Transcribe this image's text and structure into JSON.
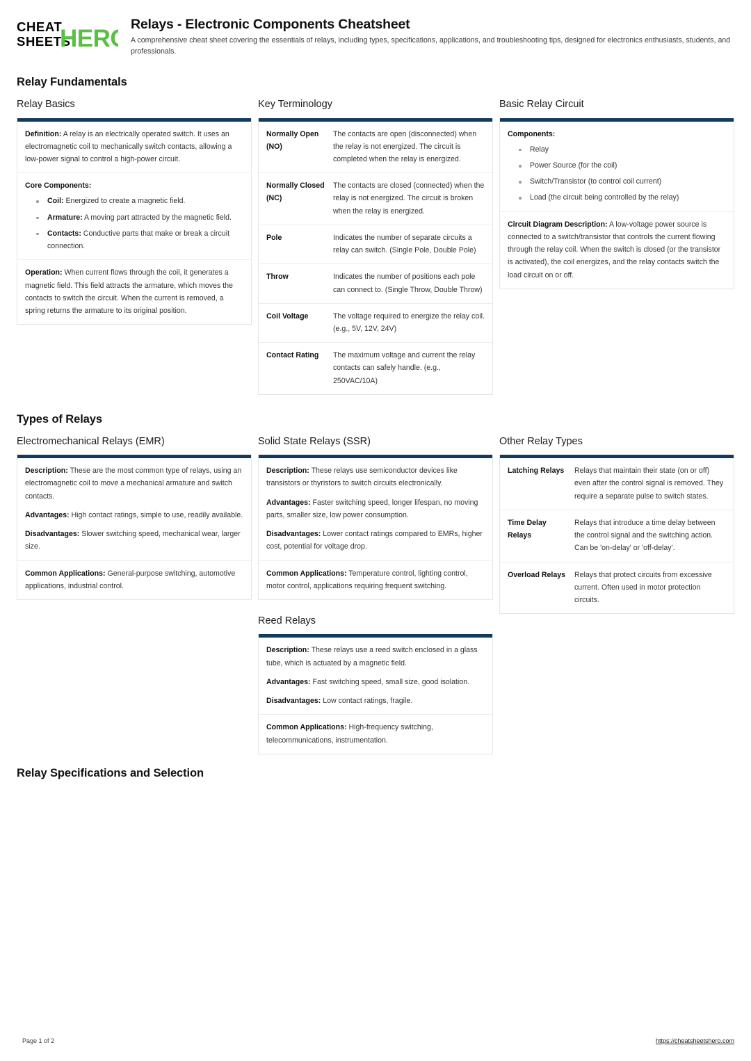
{
  "brand": {
    "line1": "CHEAT",
    "line2": "SHEETS",
    "accent_word": "HERO",
    "accent_color": "#5cbf45",
    "text_color": "#000000"
  },
  "header": {
    "title": "Relays - Electronic Components Cheatsheet",
    "subtitle": "A comprehensive cheat sheet covering the essentials of relays, including types, specifications, applications, and troubleshooting tips, designed for electronics enthusiasts, students, and professionals."
  },
  "theme": {
    "accent_bar": "#143a5e",
    "card_border": "#e4e4e4",
    "row_divider": "#ededed"
  },
  "sections": [
    {
      "id": "fundamentals",
      "title": "Relay Fundamentals"
    },
    {
      "id": "types",
      "title": "Types of Relays"
    },
    {
      "id": "specs",
      "title": "Relay Specifications and Selection"
    }
  ],
  "cards": {
    "relay_basics": {
      "title": "Relay Basics",
      "definition_label": "Definition:",
      "definition_text": " A relay is an electrically operated switch. It uses an electromagnetic coil to mechanically switch contacts, allowing a low-power signal to control a high-power circuit.",
      "core_label": "Core Components:",
      "core_items": [
        {
          "term": "Coil:",
          "desc": " Energized to create a magnetic field."
        },
        {
          "term": "Armature:",
          "desc": " A moving part attracted by the magnetic field."
        },
        {
          "term": "Contacts:",
          "desc": " Conductive parts that make or break a circuit connection."
        }
      ],
      "operation_label": "Operation:",
      "operation_text": " When current flows through the coil, it generates a magnetic field. This field attracts the armature, which moves the contacts to switch the circuit. When the current is removed, a spring returns the armature to its original position."
    },
    "key_terminology": {
      "title": "Key Terminology",
      "rows": [
        {
          "key": "Normally Open (NO)",
          "value": "The contacts are open (disconnected) when the relay is not energized. The circuit is completed when the relay is energized."
        },
        {
          "key": "Normally Closed (NC)",
          "value": "The contacts are closed (connected) when the relay is not energized. The circuit is broken when the relay is energized."
        },
        {
          "key": "Pole",
          "value": "Indicates the number of separate circuits a relay can switch. (Single Pole, Double Pole)"
        },
        {
          "key": "Throw",
          "value": "Indicates the number of positions each pole can connect to. (Single Throw, Double Throw)"
        },
        {
          "key": "Coil Voltage",
          "value": "The voltage required to energize the relay coil. (e.g., 5V, 12V, 24V)"
        },
        {
          "key": "Contact Rating",
          "value": "The maximum voltage and current the relay contacts can safely handle. (e.g., 250VAC/10A)"
        }
      ]
    },
    "basic_relay_circuit": {
      "title": "Basic Relay Circuit",
      "components_label": "Components:",
      "components": [
        "Relay",
        "Power Source (for the coil)",
        "Switch/Transistor (to control coil current)",
        "Load (the circuit being controlled by the relay)"
      ],
      "diagram_label": "Circuit Diagram Description:",
      "diagram_text": " A low-voltage power source is connected to a switch/transistor that controls the current flowing through the relay coil. When the switch is closed (or the transistor is activated), the coil energizes, and the relay contacts switch the load circuit on or off."
    },
    "emr": {
      "title": "Electromechanical Relays (EMR)",
      "description_label": "Description:",
      "description_text": " These are the most common type of relays, using an electromagnetic coil to move a mechanical armature and switch contacts.",
      "advantages_label": "Advantages:",
      "advantages_text": " High contact ratings, simple to use, readily available.",
      "disadvantages_label": "Disadvantages:",
      "disadvantages_text": " Slower switching speed, mechanical wear, larger size.",
      "applications_label": "Common Applications:",
      "applications_text": " General-purpose switching, automotive applications, industrial control."
    },
    "ssr": {
      "title": "Solid State Relays (SSR)",
      "description_label": "Description:",
      "description_text": " These relays use semiconductor devices like transistors or thyristors to switch circuits electronically.",
      "advantages_label": "Advantages:",
      "advantages_text": " Faster switching speed, longer lifespan, no moving parts, smaller size, low power consumption.",
      "disadvantages_label": "Disadvantages:",
      "disadvantages_text": " Lower contact ratings compared to EMRs, higher cost, potential for voltage drop.",
      "applications_label": "Common Applications:",
      "applications_text": " Temperature control, lighting control, motor control, applications requiring frequent switching."
    },
    "reed": {
      "title": "Reed Relays",
      "description_label": "Description:",
      "description_text": " These relays use a reed switch enclosed in a glass tube, which is actuated by a magnetic field.",
      "advantages_label": "Advantages:",
      "advantages_text": " Fast switching speed, small size, good isolation.",
      "disadvantages_label": "Disadvantages:",
      "disadvantages_text": " Low contact ratings, fragile.",
      "applications_label": "Common Applications:",
      "applications_text": " High-frequency switching, telecommunications, instrumentation."
    },
    "other_relay_types": {
      "title": "Other Relay Types",
      "rows": [
        {
          "key": "Latching Relays",
          "value": "Relays that maintain their state (on or off) even after the control signal is removed. They require a separate pulse to switch states."
        },
        {
          "key": "Time Delay Relays",
          "value": "Relays that introduce a time delay between the control signal and the switching action. Can be 'on-delay' or 'off-delay'."
        },
        {
          "key": "Overload Relays",
          "value": "Relays that protect circuits from excessive current. Often used in motor protection circuits."
        }
      ]
    }
  },
  "footer": {
    "page_label": "Page 1 of 2",
    "url": "https://cheatsheetshero.com"
  }
}
